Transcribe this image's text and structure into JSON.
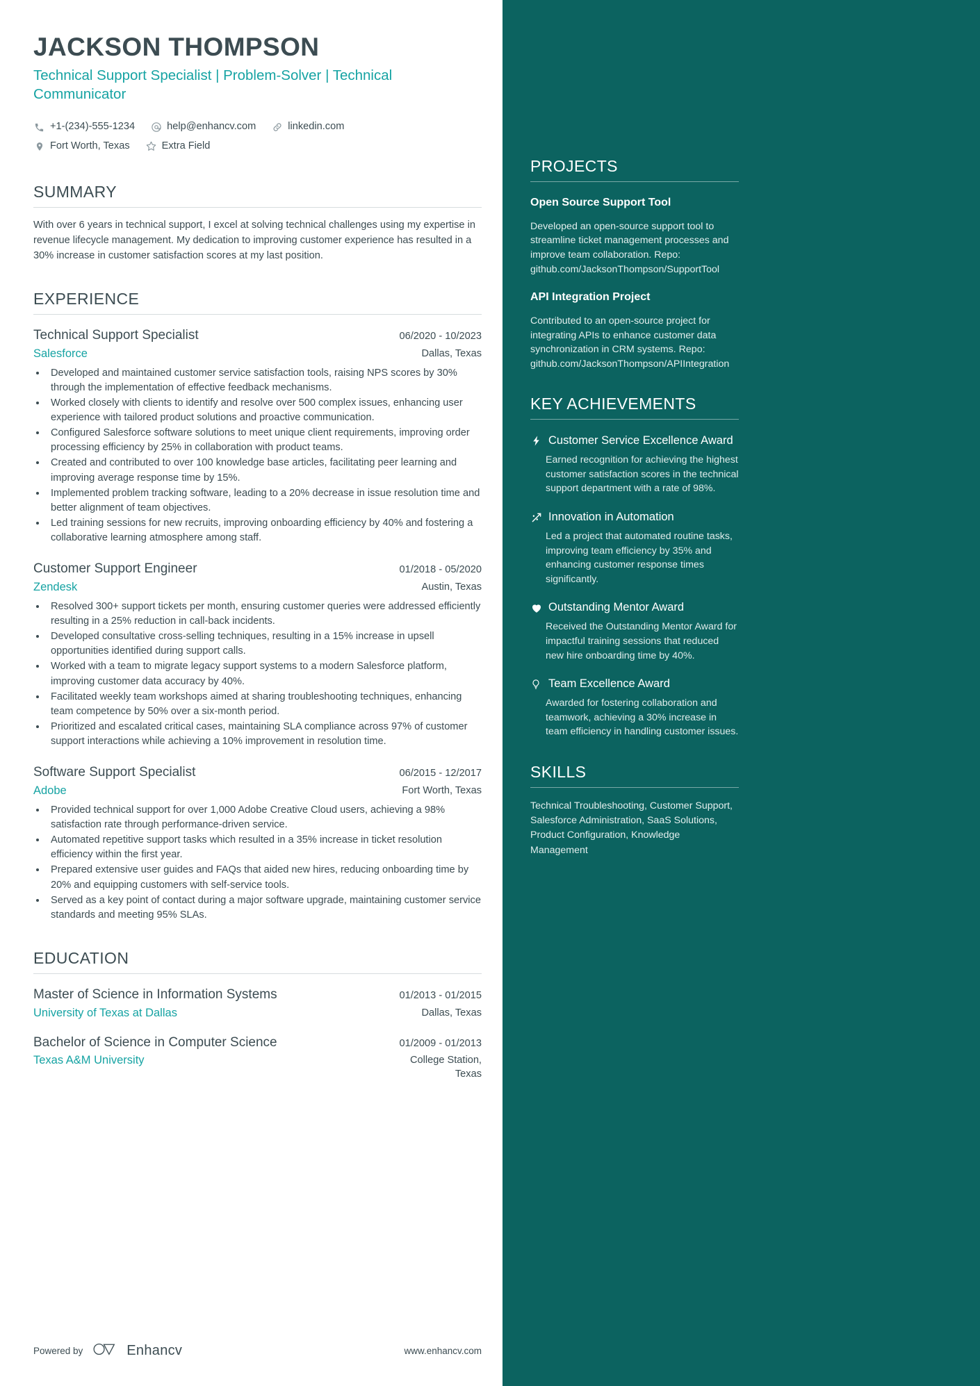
{
  "header": {
    "name": "JACKSON THOMPSON",
    "headline": "Technical Support Specialist | Problem-Solver | Technical Communicator",
    "contacts": [
      {
        "icon": "phone-icon",
        "text": "+1-(234)-555-1234"
      },
      {
        "icon": "email-icon",
        "text": "help@enhancv.com"
      },
      {
        "icon": "link-icon",
        "text": "linkedin.com"
      },
      {
        "icon": "location-icon",
        "text": "Fort Worth, Texas"
      },
      {
        "icon": "star-icon",
        "text": "Extra Field"
      }
    ]
  },
  "summary": {
    "title": "SUMMARY",
    "text": "With over 6 years in technical support, I excel at solving technical challenges using my expertise in revenue lifecycle management. My dedication to improving customer experience has resulted in a 30% increase in customer satisfaction scores at my last position."
  },
  "experience": {
    "title": "EXPERIENCE",
    "entries": [
      {
        "role": "Technical Support Specialist",
        "date": "06/2020 - 10/2023",
        "company": "Salesforce",
        "location": "Dallas, Texas",
        "bullets": [
          "Developed and maintained customer service satisfaction tools, raising NPS scores by 30% through the implementation of effective feedback mechanisms.",
          "Worked closely with clients to identify and resolve over 500 complex issues, enhancing user experience with tailored product solutions and proactive communication.",
          "Configured Salesforce software solutions to meet unique client requirements, improving order processing efficiency by 25% in collaboration with product teams.",
          "Created and contributed to over 100 knowledge base articles, facilitating peer learning and improving average response time by 15%.",
          "Implemented problem tracking software, leading to a 20% decrease in issue resolution time and better alignment of team objectives.",
          "Led training sessions for new recruits, improving onboarding efficiency by 40% and fostering a collaborative learning atmosphere among staff."
        ]
      },
      {
        "role": "Customer Support Engineer",
        "date": "01/2018 - 05/2020",
        "company": "Zendesk",
        "location": "Austin, Texas",
        "bullets": [
          "Resolved 300+ support tickets per month, ensuring customer queries were addressed efficiently resulting in a 25% reduction in call-back incidents.",
          "Developed consultative cross-selling techniques, resulting in a 15% increase in upsell opportunities identified during support calls.",
          "Worked with a team to migrate legacy support systems to a modern Salesforce platform, improving customer data accuracy by 40%.",
          "Facilitated weekly team workshops aimed at sharing troubleshooting techniques, enhancing team competence by 50% over a six-month period.",
          "Prioritized and escalated critical cases, maintaining SLA compliance across 97% of customer support interactions while achieving a 10% improvement in resolution time."
        ]
      },
      {
        "role": "Software Support Specialist",
        "date": "06/2015 - 12/2017",
        "company": "Adobe",
        "location": "Fort Worth, Texas",
        "bullets": [
          "Provided technical support for over 1,000 Adobe Creative Cloud users, achieving a 98% satisfaction rate through performance-driven service.",
          "Automated repetitive support tasks which resulted in a 35% increase in ticket resolution efficiency within the first year.",
          "Prepared extensive user guides and FAQs that aided new hires, reducing onboarding time by 20% and equipping customers with self-service tools.",
          "Served as a key point of contact during a major software upgrade, maintaining customer service standards and meeting 95% SLAs."
        ]
      }
    ]
  },
  "education": {
    "title": "EDUCATION",
    "entries": [
      {
        "degree": "Master of Science in Information Systems",
        "date": "01/2013 - 01/2015",
        "school": "University of Texas at Dallas",
        "location": "Dallas, Texas"
      },
      {
        "degree": "Bachelor of Science in Computer Science",
        "date": "01/2009 - 01/2013",
        "school": "Texas A&M University",
        "location": "College Station, Texas"
      }
    ]
  },
  "projects": {
    "title": "PROJECTS",
    "entries": [
      {
        "name": "Open Source Support Tool",
        "description": "Developed an open-source support tool to streamline ticket management processes and improve team collaboration. Repo: github.com/JacksonThompson/SupportTool"
      },
      {
        "name": "API Integration Project",
        "description": "Contributed to an open-source project for integrating APIs to enhance customer data synchronization in CRM systems. Repo: github.com/JacksonThompson/APIIntegration"
      }
    ]
  },
  "achievements": {
    "title": "KEY ACHIEVEMENTS",
    "entries": [
      {
        "icon": "lightning-bolt-icon",
        "title": "Customer Service Excellence Award",
        "description": "Earned recognition for achieving the highest customer satisfaction scores in the technical support department with a rate of 98%."
      },
      {
        "icon": "trend-scatter-icon",
        "title": "Innovation in Automation",
        "description": "Led a project that automated routine tasks, improving team efficiency by 35% and enhancing customer response times significantly."
      },
      {
        "icon": "heart-icon",
        "title": "Outstanding Mentor Award",
        "description": "Received the Outstanding Mentor Award for impactful training sessions that reduced new hire onboarding time by 40%."
      },
      {
        "icon": "lightbulb-icon",
        "title": "Team Excellence Award",
        "description": "Awarded for fostering collaboration and teamwork, achieving a 30% increase in team efficiency in handling customer issues."
      }
    ]
  },
  "skills": {
    "title": "SKILLS",
    "text": "Technical Troubleshooting, Customer Support, Salesforce Administration, SaaS Solutions, Product Configuration, Knowledge Management"
  },
  "footer": {
    "powered_by": "Powered by",
    "brand": "Enhancv",
    "website": "www.enhancv.com"
  },
  "colors": {
    "accent_teal": "#16a3a3",
    "sidebar_bg": "#0c6360",
    "text_dark": "#3c4c52"
  }
}
